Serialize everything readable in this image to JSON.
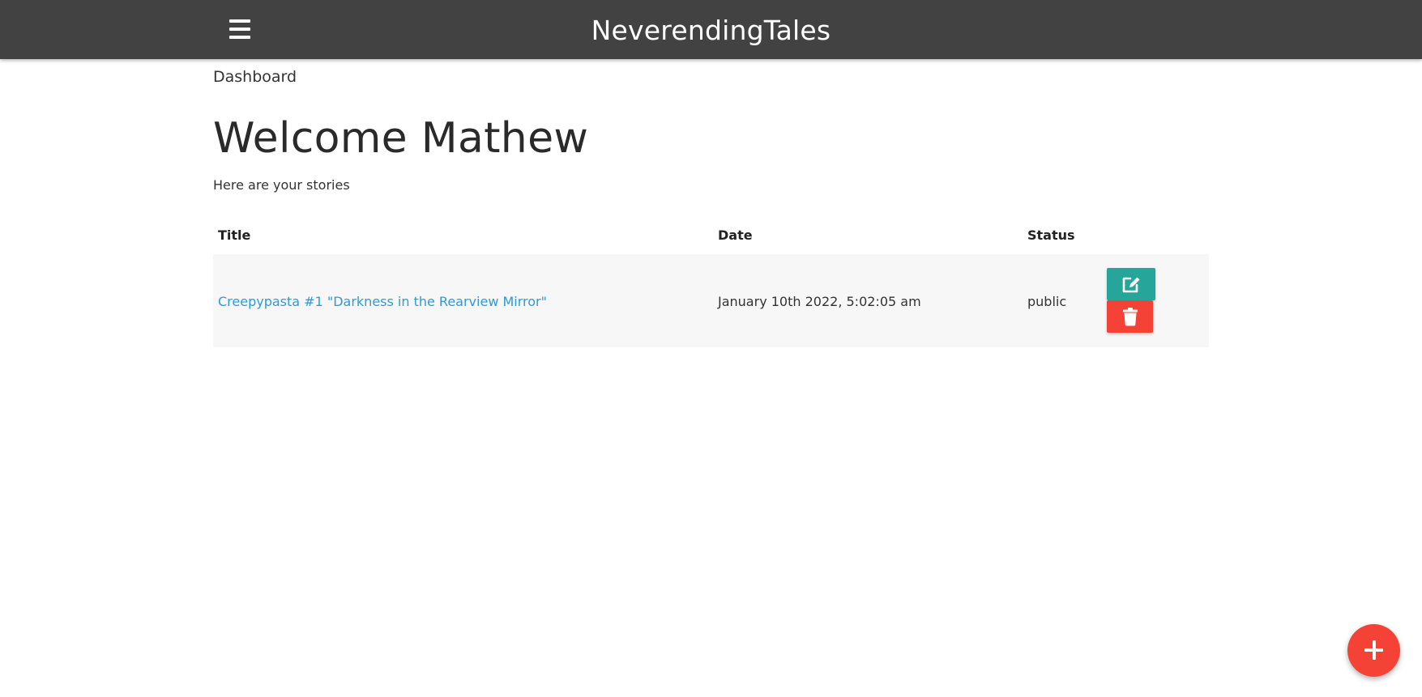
{
  "navbar": {
    "brand": "NeverendingTales",
    "menu_icon": "hamburger-menu-icon"
  },
  "breadcrumb": "Dashboard",
  "welcome": "Welcome Mathew",
  "subtitle": "Here are your stories",
  "table": {
    "headers": [
      "Title",
      "Date",
      "Status"
    ],
    "rows": [
      {
        "title": "Creepypasta #1 \"Darkness in the Rearview Mirror\"",
        "date": "January 10th 2022, 5:02:05 am",
        "status": "public",
        "edit_icon": "edit-pencil-square-icon",
        "delete_icon": "trash-icon"
      }
    ]
  },
  "fab_icon": "plus-icon",
  "colors": {
    "navbar": "#424242",
    "link": "#2e9bd6",
    "edit": "#26a69a",
    "delete": "#f44336",
    "row_bg": "#f7f7f7"
  }
}
